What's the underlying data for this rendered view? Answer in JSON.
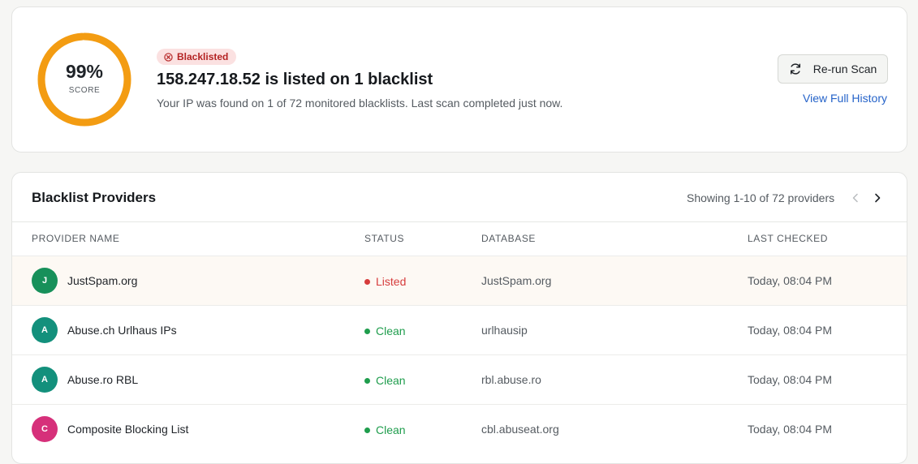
{
  "summary": {
    "score": {
      "value": "99%",
      "label": "SCORE",
      "fraction": 0.99,
      "color": "#f39c12"
    },
    "badge": {
      "label": "Blacklisted",
      "icon": "x-circle-icon"
    },
    "headline": "158.247.18.52 is listed on 1 blacklist",
    "description": "Your IP was found on 1 of 72 monitored blacklists. Last scan completed just now.",
    "rerun_button": {
      "label": "Re-run Scan",
      "icon": "refresh-icon"
    },
    "history_link": "View Full History"
  },
  "providers": {
    "title": "Blacklist Providers",
    "showing": "Showing 1-10 of 72 providers",
    "columns": [
      "PROVIDER NAME",
      "STATUS",
      "DATABASE",
      "LAST CHECKED"
    ],
    "rows": [
      {
        "initial": "J",
        "avatar_color": "#17905a",
        "name": "JustSpam.org",
        "status": "Listed",
        "status_color": "#d63c3c",
        "database": "JustSpam.org",
        "last_checked": "Today, 08:04 PM"
      },
      {
        "initial": "A",
        "avatar_color": "#13907c",
        "name": "Abuse.ch Urlhaus IPs",
        "status": "Clean",
        "status_color": "#1f9d4d",
        "database": "urlhausip",
        "last_checked": "Today, 08:04 PM"
      },
      {
        "initial": "A",
        "avatar_color": "#13907c",
        "name": "Abuse.ro RBL",
        "status": "Clean",
        "status_color": "#1f9d4d",
        "database": "rbl.abuse.ro",
        "last_checked": "Today, 08:04 PM"
      },
      {
        "initial": "C",
        "avatar_color": "#d6307a",
        "name": "Composite Blocking List",
        "status": "Clean",
        "status_color": "#1f9d4d",
        "database": "cbl.abuseat.org",
        "last_checked": "Today, 08:04 PM"
      }
    ]
  },
  "colors": {
    "accent": "#2563c9",
    "listed": "#d63c3c",
    "clean": "#1f9d4d",
    "ring": "#f39c12"
  }
}
